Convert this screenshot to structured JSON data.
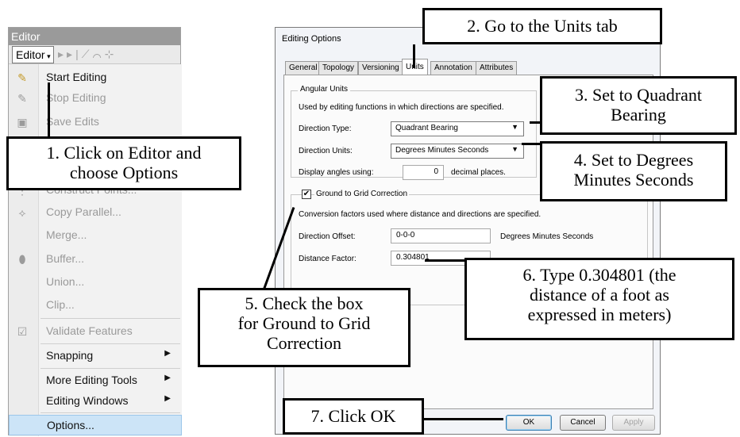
{
  "editor": {
    "titlebar": "Editor",
    "editor_button": "Editor",
    "menu_items": [
      {
        "label": "Start Editing",
        "icon": "pencil-icon",
        "disabled": false
      },
      {
        "label": "Stop Editing",
        "icon": "stop-pencil-icon",
        "disabled": true
      },
      {
        "label": "Save Edits",
        "icon": "save-icon",
        "disabled": true
      },
      {
        "label": "Construct Points...",
        "icon": "points-icon",
        "disabled": true
      },
      {
        "label": "Copy Parallel...",
        "icon": "copy-parallel-icon",
        "disabled": true
      },
      {
        "label": "Merge...",
        "icon": "",
        "disabled": true
      },
      {
        "label": "Buffer...",
        "icon": "buffer-icon",
        "disabled": true
      },
      {
        "label": "Union...",
        "icon": "",
        "disabled": true
      },
      {
        "label": "Clip...",
        "icon": "",
        "disabled": true
      },
      {
        "label": "Validate Features",
        "icon": "validate-icon",
        "disabled": true
      },
      {
        "label": "Snapping",
        "icon": "",
        "disabled": false,
        "submenu": true
      },
      {
        "label": "More Editing Tools",
        "icon": "",
        "disabled": false,
        "submenu": true
      },
      {
        "label": "Editing Windows",
        "icon": "",
        "disabled": false,
        "submenu": true
      },
      {
        "label": "Options...",
        "icon": "",
        "disabled": false,
        "highlighted": true
      }
    ]
  },
  "dialog": {
    "title": "Editing Options",
    "tabs": [
      "General",
      "Topology",
      "Versioning",
      "Units",
      "Annotation",
      "Attributes"
    ],
    "active_tab": "Units",
    "angular_units": {
      "group_title": "Angular Units",
      "description": "Used by editing functions in which directions are specified.",
      "direction_type_label": "Direction Type:",
      "direction_type_value": "Quadrant Bearing",
      "direction_units_label": "Direction Units:",
      "direction_units_value": "Degrees Minutes Seconds",
      "display_angles_label": "Display angles using:",
      "display_angles_value": "0",
      "decimal_places_label": "decimal places."
    },
    "ground_to_grid": {
      "checkbox_label": "Ground to Grid Correction",
      "checked": true,
      "description": "Conversion factors used where distance and directions are specified.",
      "direction_offset_label": "Direction Offset:",
      "direction_offset_value": "0-0-0",
      "direction_offset_units": "Degrees Minutes Seconds",
      "distance_factor_label": "Distance Factor:",
      "distance_factor_value": "0.304801"
    },
    "buttons": {
      "ok": "OK",
      "cancel": "Cancel",
      "apply": "Apply"
    }
  },
  "callouts": {
    "step1_line1": "1. Click on Editor and",
    "step1_line2": "choose Options",
    "step2": "2. Go to the Units tab",
    "step3_line1": "3. Set to Quadrant",
    "step3_line2": "Bearing",
    "step4_line1": "4. Set to Degrees",
    "step4_line2": "Minutes Seconds",
    "step5_line1": "5. Check the box",
    "step5_line2": "for Ground to Grid",
    "step5_line3": "Correction",
    "step6_line1": "6. Type 0.304801 (the",
    "step6_line2": "distance of a foot as",
    "step6_line3": "expressed in meters)",
    "step7": "7. Click OK"
  }
}
